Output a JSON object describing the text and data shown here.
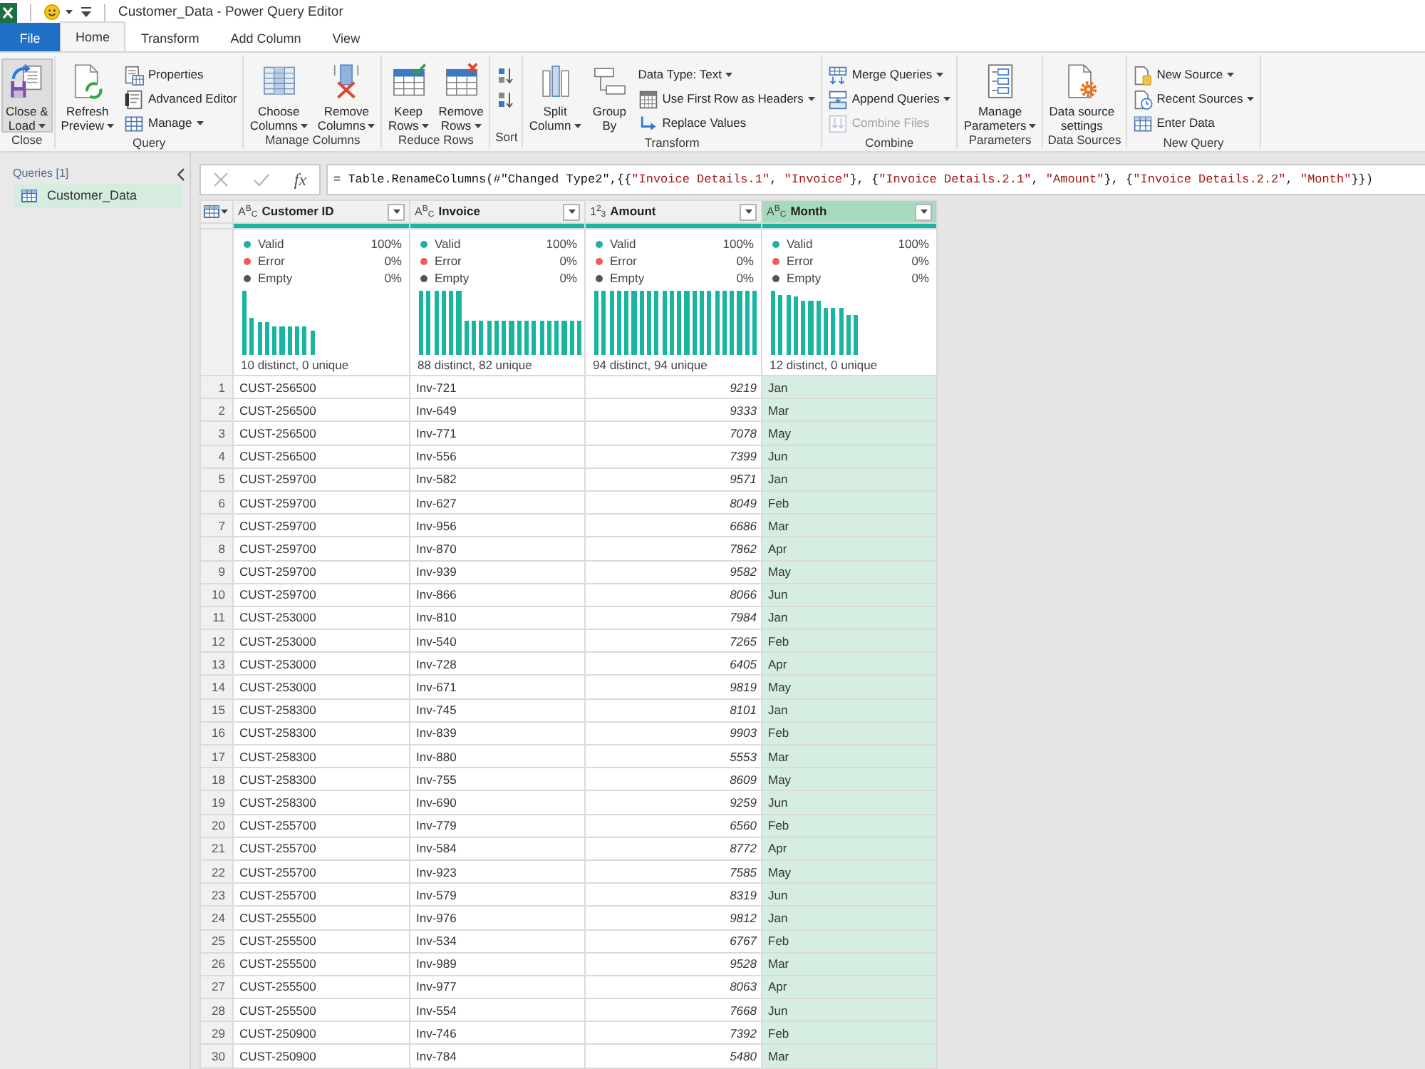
{
  "title_bar": {
    "title": "Customer_Data - Power Query Editor"
  },
  "tabs": [
    {
      "label": "File",
      "kind": "file",
      "selected": false
    },
    {
      "label": "Home",
      "kind": "tab",
      "selected": true
    },
    {
      "label": "Transform",
      "kind": "tab",
      "selected": false
    },
    {
      "label": "Add Column",
      "kind": "tab",
      "selected": false
    },
    {
      "label": "View",
      "kind": "tab",
      "selected": false
    }
  ],
  "ribbon": {
    "groups": [
      {
        "label": "Close",
        "items": [
          {
            "kind": "large",
            "label": [
              "Close &",
              "Load"
            ],
            "dropdown": true,
            "disabled": false,
            "highlighted": true
          }
        ]
      },
      {
        "label": "Query",
        "items": [
          {
            "kind": "large",
            "label": [
              "Refresh",
              "Preview"
            ],
            "dropdown": true,
            "disabled": false,
            "highlighted": false
          },
          {
            "kind": "small",
            "label": "Properties",
            "dropdown": false,
            "disabled": false,
            "highlighted": false
          },
          {
            "kind": "small",
            "label": "Advanced Editor",
            "dropdown": false,
            "disabled": false,
            "highlighted": false
          },
          {
            "kind": "small",
            "label": "Manage",
            "dropdown": true,
            "disabled": false,
            "highlighted": false
          }
        ]
      },
      {
        "label": "Manage Columns",
        "items": [
          {
            "kind": "large",
            "label": [
              "Choose",
              "Columns"
            ],
            "dropdown": true,
            "disabled": false,
            "highlighted": false
          },
          {
            "kind": "large",
            "label": [
              "Remove",
              "Columns"
            ],
            "dropdown": true,
            "disabled": false,
            "highlighted": false
          }
        ]
      },
      {
        "label": "Reduce Rows",
        "items": [
          {
            "kind": "large",
            "label": [
              "Keep",
              "Rows"
            ],
            "dropdown": true,
            "disabled": false,
            "highlighted": false
          },
          {
            "kind": "large",
            "label": [
              "Remove",
              "Rows"
            ],
            "dropdown": true,
            "disabled": false,
            "highlighted": false
          }
        ]
      },
      {
        "label": "Sort",
        "items": [
          {
            "kind": "icon",
            "dropdown": false,
            "disabled": false,
            "highlighted": false
          },
          {
            "kind": "icon",
            "dropdown": false,
            "disabled": false,
            "highlighted": false
          }
        ]
      },
      {
        "label": "Transform",
        "items": [
          {
            "kind": "large",
            "label": [
              "Split",
              "Column"
            ],
            "dropdown": true,
            "disabled": false,
            "highlighted": false
          },
          {
            "kind": "large",
            "label": [
              "Group",
              "By"
            ],
            "dropdown": false,
            "disabled": false,
            "highlighted": false
          },
          {
            "kind": "small",
            "label": "Data Type: Text",
            "dropdown": true,
            "disabled": false,
            "highlighted": false
          },
          {
            "kind": "small",
            "label": "Use First Row as Headers",
            "dropdown": true,
            "disabled": false,
            "highlighted": false
          },
          {
            "kind": "small",
            "label": "Replace Values",
            "dropdown": false,
            "disabled": false,
            "highlighted": false
          }
        ]
      },
      {
        "label": "Combine",
        "items": [
          {
            "kind": "small",
            "label": "Merge Queries",
            "dropdown": true,
            "disabled": false,
            "highlighted": false
          },
          {
            "kind": "small",
            "label": "Append Queries",
            "dropdown": true,
            "disabled": false,
            "highlighted": false
          },
          {
            "kind": "small",
            "label": "Combine Files",
            "dropdown": false,
            "disabled": true,
            "highlighted": false
          }
        ]
      },
      {
        "label": "Parameters",
        "items": [
          {
            "kind": "large",
            "label": [
              "Manage",
              "Parameters"
            ],
            "dropdown": true,
            "disabled": false,
            "highlighted": false
          }
        ]
      },
      {
        "label": "Data Sources",
        "items": [
          {
            "kind": "large",
            "label": [
              "Data source",
              "settings"
            ],
            "dropdown": false,
            "disabled": false,
            "highlighted": false
          }
        ]
      },
      {
        "label": "New Query",
        "items": [
          {
            "kind": "small",
            "label": "New Source",
            "dropdown": true,
            "disabled": false,
            "highlighted": false
          },
          {
            "kind": "small",
            "label": "Recent Sources",
            "dropdown": true,
            "disabled": false,
            "highlighted": false
          },
          {
            "kind": "small",
            "label": "Enter Data",
            "dropdown": false,
            "disabled": false,
            "highlighted": false
          }
        ]
      }
    ]
  },
  "queries_pane": {
    "title": "Queries [1]",
    "queries": [
      {
        "name": "Customer_Data",
        "selected": true
      }
    ]
  },
  "formula_bar": {
    "buttons": [
      {
        "kind": "cancel",
        "disabled": true
      },
      {
        "kind": "commit",
        "disabled": true
      },
      {
        "kind": "function",
        "label": "fx",
        "disabled": false
      }
    ],
    "formula": [
      {
        "kind": "plain",
        "text": "= Table.RenameColumns(#\"Changed Type2\",{{"
      },
      {
        "kind": "string",
        "text": "\"Invoice Details.1\""
      },
      {
        "kind": "plain",
        "text": ", "
      },
      {
        "kind": "string",
        "text": "\"Invoice\""
      },
      {
        "kind": "plain",
        "text": "}, {"
      },
      {
        "kind": "string",
        "text": "\"Invoice Details.2.1\""
      },
      {
        "kind": "plain",
        "text": ", "
      },
      {
        "kind": "string",
        "text": "\"Amount\""
      },
      {
        "kind": "plain",
        "text": "}, {"
      },
      {
        "kind": "string",
        "text": "\"Invoice Details.2.2\""
      },
      {
        "kind": "plain",
        "text": ", "
      },
      {
        "kind": "string",
        "text": "\"Month\""
      },
      {
        "kind": "plain",
        "text": "}})"
      }
    ]
  },
  "table": {
    "columns": [
      {
        "name": "Customer ID",
        "type_label": "A$^{B}$$_{C}$",
        "kind": "text",
        "selected": false,
        "level": 1,
        "stats": [
          {
            "label": "Valid",
            "value": "100%",
            "color": "#1ab5a0"
          },
          {
            "label": "Error",
            "value": "0%",
            "color": "#f05a5a"
          },
          {
            "label": "Empty",
            "value": "0%",
            "color": "#555555"
          }
        ],
        "summary": "10 distinct, 0 unique"
      },
      {
        "name": "Invoice",
        "type_label": "A$^{B}$$_{C}$",
        "kind": "text",
        "selected": false,
        "level": 1,
        "stats": [
          {
            "label": "Valid",
            "value": "100%",
            "color": "#1ab5a0"
          },
          {
            "label": "Error",
            "value": "0%",
            "color": "#f05a5a"
          },
          {
            "label": "Empty",
            "value": "0%",
            "color": "#555555"
          }
        ],
        "summary": "88 distinct, 82 unique"
      },
      {
        "name": "Amount",
        "type_label": "1$^{2}$$_{3}$",
        "kind": "number",
        "selected": false,
        "level": 1,
        "stats": [
          {
            "label": "Valid",
            "value": "100%",
            "color": "#1ab5a0"
          },
          {
            "label": "Error",
            "value": "0%",
            "color": "#f05a5a"
          },
          {
            "label": "Empty",
            "value": "0%",
            "color": "#555555"
          }
        ],
        "summary": "94 distinct, 94 unique"
      },
      {
        "name": "Month",
        "type_label": "A$^{B}$$_{C}$",
        "kind": "text",
        "selected": true,
        "level": 1,
        "stats": [
          {
            "label": "Valid",
            "value": "100%",
            "color": "#1ab5a0"
          },
          {
            "label": "Error",
            "value": "0%",
            "color": "#f05a5a"
          },
          {
            "label": "Empty",
            "value": "0%",
            "color": "#555555"
          }
        ],
        "summary": "12 distinct, 0 unique"
      }
    ],
    "rows": [
      {
        "number": "1",
        "cells": [
          "CUST-256500",
          "Inv-721",
          "9219",
          "Jan"
        ]
      },
      {
        "number": "2",
        "cells": [
          "CUST-256500",
          "Inv-649",
          "9333",
          "Mar"
        ]
      },
      {
        "number": "3",
        "cells": [
          "CUST-256500",
          "Inv-771",
          "7078",
          "May"
        ]
      },
      {
        "number": "4",
        "cells": [
          "CUST-256500",
          "Inv-556",
          "7399",
          "Jun"
        ]
      },
      {
        "number": "5",
        "cells": [
          "CUST-259700",
          "Inv-582",
          "9571",
          "Jan"
        ]
      },
      {
        "number": "6",
        "cells": [
          "CUST-259700",
          "Inv-627",
          "8049",
          "Feb"
        ]
      },
      {
        "number": "7",
        "cells": [
          "CUST-259700",
          "Inv-956",
          "6686",
          "Mar"
        ]
      },
      {
        "number": "8",
        "cells": [
          "CUST-259700",
          "Inv-870",
          "7862",
          "Apr"
        ]
      },
      {
        "number": "9",
        "cells": [
          "CUST-259700",
          "Inv-939",
          "9582",
          "May"
        ]
      },
      {
        "number": "10",
        "cells": [
          "CUST-259700",
          "Inv-866",
          "8066",
          "Jun"
        ]
      },
      {
        "number": "11",
        "cells": [
          "CUST-253000",
          "Inv-810",
          "7984",
          "Jan"
        ]
      },
      {
        "number": "12",
        "cells": [
          "CUST-253000",
          "Inv-540",
          "7265",
          "Feb"
        ]
      },
      {
        "number": "13",
        "cells": [
          "CUST-253000",
          "Inv-728",
          "6405",
          "Apr"
        ]
      },
      {
        "number": "14",
        "cells": [
          "CUST-253000",
          "Inv-671",
          "9819",
          "May"
        ]
      },
      {
        "number": "15",
        "cells": [
          "CUST-258300",
          "Inv-745",
          "8101",
          "Jan"
        ]
      },
      {
        "number": "16",
        "cells": [
          "CUST-258300",
          "Inv-839",
          "9903",
          "Feb"
        ]
      },
      {
        "number": "17",
        "cells": [
          "CUST-258300",
          "Inv-880",
          "5553",
          "Mar"
        ]
      },
      {
        "number": "18",
        "cells": [
          "CUST-258300",
          "Inv-755",
          "8609",
          "May"
        ]
      },
      {
        "number": "19",
        "cells": [
          "CUST-258300",
          "Inv-690",
          "9259",
          "Jun"
        ]
      },
      {
        "number": "20",
        "cells": [
          "CUST-255700",
          "Inv-779",
          "6560",
          "Feb"
        ]
      },
      {
        "number": "21",
        "cells": [
          "CUST-255700",
          "Inv-584",
          "8772",
          "Apr"
        ]
      },
      {
        "number": "22",
        "cells": [
          "CUST-255700",
          "Inv-923",
          "7585",
          "May"
        ]
      },
      {
        "number": "23",
        "cells": [
          "CUST-255700",
          "Inv-579",
          "8319",
          "Jun"
        ]
      },
      {
        "number": "24",
        "cells": [
          "CUST-255500",
          "Inv-976",
          "9812",
          "Jan"
        ]
      },
      {
        "number": "25",
        "cells": [
          "CUST-255500",
          "Inv-534",
          "6767",
          "Feb"
        ]
      },
      {
        "number": "26",
        "cells": [
          "CUST-255500",
          "Inv-989",
          "9528",
          "Mar"
        ]
      },
      {
        "number": "27",
        "cells": [
          "CUST-255500",
          "Inv-977",
          "8063",
          "Apr"
        ]
      },
      {
        "number": "28",
        "cells": [
          "CUST-255500",
          "Inv-554",
          "7668",
          "Jun"
        ]
      },
      {
        "number": "29",
        "cells": [
          "CUST-250900",
          "Inv-746",
          "7392",
          "Feb"
        ]
      },
      {
        "number": "30",
        "cells": [
          "CUST-250900",
          "Inv-784",
          "5480",
          "Mar"
        ]
      }
    ]
  }
}
